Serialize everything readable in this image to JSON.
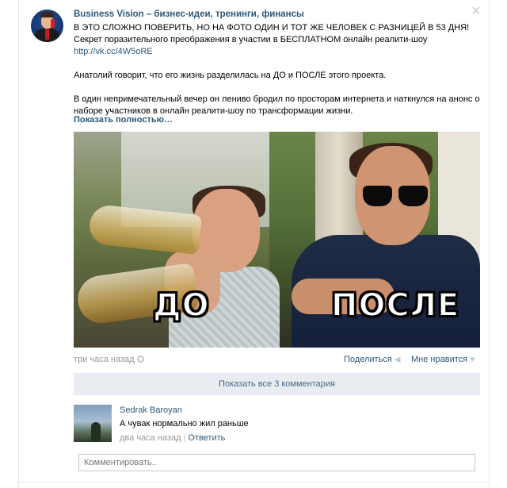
{
  "post": {
    "author": "Business Vision – бизнес-идеи, тренинги, финансы",
    "paragraph1_text": "В ЭТО СЛОЖНО ПОВЕРИТЬ, НО НА ФОТО ОДИН И ТОТ ЖЕ ЧЕЛОВЕК С РАЗНИЦЕЙ В 53 ДНЯ! Секрет поразительного преображения в участии в БЕСПЛАТНОМ онлайн реалити-шоу ",
    "paragraph1_link": "http://vk.cc/4W5oRE",
    "paragraph2": "Анатолий говорит, что его жизнь разделилась на ДО и ПОСЛЕ этого проекта.",
    "paragraph3": "В один непримечательный вечер он лениво бродил по просторам интернета и наткнулся на анонс о наборе участников в онлайн реалити-шоу по трансформации жизни.",
    "show_more": "Показать полностью…",
    "image": {
      "label_before": "ДО",
      "label_after": "ПОСЛЕ"
    },
    "time": "три часа назад",
    "share_label": "Поделиться",
    "like_label": "Мне нравится",
    "show_all_comments": "Показать все 3 комментария"
  },
  "comment": {
    "author": "Sedrak Baroyan",
    "text": "А чувак нормально жил раньше",
    "time": "два часа назад",
    "separator": "|",
    "reply": "Ответить"
  },
  "comment_input": {
    "placeholder": "Комментировать.."
  },
  "colors": {
    "link": "#2b587a",
    "meta": "#999999",
    "button_bg": "#e9edf1"
  }
}
